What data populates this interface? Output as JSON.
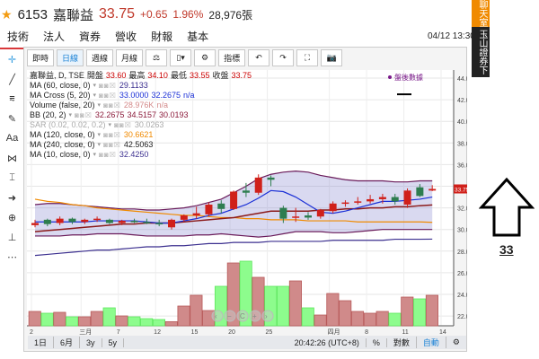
{
  "header": {
    "code": "6153",
    "name": "嘉聯益",
    "price": "33.75",
    "change": "+0.65",
    "pct": "1.96%",
    "volume": "28,976張",
    "datetime": "04/12 13:30"
  },
  "tabs": [
    "技術",
    "法人",
    "資券",
    "營收",
    "財報",
    "基本"
  ],
  "toolbar": {
    "items": [
      "即時",
      "日線",
      "週線",
      "月線",
      "⚖",
      "▯▾",
      "⚙",
      "指標",
      "↶",
      "↷",
      "⛶",
      "📷"
    ]
  },
  "left_tools": [
    "crosshair",
    "line",
    "channel",
    "brush",
    "Aa",
    "pattern",
    "measure",
    "arrow",
    "zoom",
    "ruler",
    "more"
  ],
  "legend": {
    "title": "嘉聯益, D, TSE",
    "open_label": "開盤",
    "open": "33.60",
    "high_label": "最高",
    "high": "34.10",
    "low_label": "最低",
    "low": "33.55",
    "close_label": "收盤",
    "close": "33.75",
    "rows": [
      {
        "label": "MA (60, close, 0)",
        "vals": [
          "29.1133"
        ],
        "color": "#3b2f8f"
      },
      {
        "label": "MA Cross (5, 20)",
        "vals": [
          "33.0000",
          "32.2675",
          "n/a"
        ],
        "color": "#1a2fd6"
      },
      {
        "label": "Volume (false, 20)",
        "vals": [
          "28.976K",
          "n/a"
        ],
        "color": "#d48a8a"
      },
      {
        "label": "BB (20, 2)",
        "vals": [
          "32.2675",
          "34.5157",
          "30.0193"
        ],
        "color": "#8b1a3a"
      },
      {
        "label": "SAR (0.02, 0.02, 0.2)",
        "vals": [
          "30.0263"
        ],
        "color": "#aaa"
      },
      {
        "label": "MA (120, close, 0)",
        "vals": [
          "30.6621"
        ],
        "color": "#f08a00"
      },
      {
        "label": "MA (240, close, 0)",
        "vals": [
          "42.5063"
        ],
        "color": "#222"
      },
      {
        "label": "MA (10, close, 0)",
        "vals": [
          "32.4250"
        ],
        "color": "#3b2f8f"
      }
    ]
  },
  "after_hours": "盤後數據",
  "last_price_tag": "33.75",
  "bottom": {
    "ranges": [
      "1日",
      "6月",
      "3y",
      "5y"
    ],
    "clock": "20:42:26 (UTC+8)",
    "pct": "%",
    "log": "對數",
    "auto": "自動"
  },
  "side": {
    "chat": "聊天室",
    "order": "玉山證券下單"
  },
  "annotation": "33",
  "chart_data": {
    "type": "candlestick",
    "ylim": [
      21,
      45
    ],
    "yticks": [
      "44.00",
      "42.00",
      "40.00",
      "38.00",
      "36.00",
      "34.00",
      "32.00",
      "30.00",
      "28.00",
      "26.00",
      "24.00",
      "22.00"
    ],
    "xticks": [
      {
        "i": 0,
        "t": "2"
      },
      {
        "i": 4,
        "t": "三月"
      },
      {
        "i": 7,
        "t": "7"
      },
      {
        "i": 10,
        "t": "12"
      },
      {
        "i": 13,
        "t": "15"
      },
      {
        "i": 16,
        "t": "20"
      },
      {
        "i": 19,
        "t": "25"
      },
      {
        "i": 24,
        "t": "四月"
      },
      {
        "i": 27,
        "t": "8"
      },
      {
        "i": 30,
        "t": "11"
      },
      {
        "i": 33,
        "t": "14"
      }
    ],
    "ohlc": [
      [
        30.4,
        30.9,
        30.2,
        30.6
      ],
      [
        30.9,
        31.0,
        30.3,
        30.5
      ],
      [
        30.6,
        31.2,
        30.4,
        31.0
      ],
      [
        31.0,
        31.1,
        30.5,
        30.7
      ],
      [
        30.7,
        31.0,
        30.5,
        30.9
      ],
      [
        30.9,
        31.2,
        30.7,
        31.0
      ],
      [
        30.9,
        31.0,
        30.5,
        30.6
      ],
      [
        30.6,
        30.9,
        30.4,
        30.8
      ],
      [
        30.8,
        31.0,
        30.6,
        30.7
      ],
      [
        30.7,
        31.0,
        30.5,
        30.6
      ],
      [
        30.6,
        30.9,
        30.3,
        30.5
      ],
      [
        30.2,
        31.0,
        30.0,
        30.9
      ],
      [
        30.9,
        31.4,
        30.7,
        31.3
      ],
      [
        31.3,
        32.1,
        31.0,
        31.5
      ],
      [
        31.4,
        32.5,
        31.2,
        32.3
      ],
      [
        32.4,
        32.7,
        31.5,
        31.9
      ],
      [
        31.9,
        33.6,
        31.8,
        33.5
      ],
      [
        33.6,
        34.3,
        33.0,
        33.4
      ],
      [
        33.4,
        35.1,
        33.2,
        34.8
      ],
      [
        34.8,
        35.0,
        34.0,
        34.6
      ],
      [
        32.0,
        32.2,
        30.6,
        31.0
      ],
      [
        31.1,
        32.0,
        30.7,
        31.2
      ],
      [
        31.3,
        31.6,
        30.9,
        31.1
      ],
      [
        31.2,
        31.9,
        31.0,
        31.8
      ],
      [
        31.7,
        32.6,
        31.5,
        32.4
      ],
      [
        32.4,
        32.7,
        32.1,
        32.5
      ],
      [
        32.6,
        33.0,
        32.3,
        32.6
      ],
      [
        32.6,
        33.2,
        32.4,
        32.8
      ],
      [
        32.8,
        33.3,
        32.4,
        33.0
      ],
      [
        33.0,
        33.3,
        32.3,
        32.6
      ],
      [
        32.3,
        33.8,
        32.0,
        33.6
      ],
      [
        33.9,
        34.2,
        33.0,
        33.1
      ],
      [
        33.6,
        34.1,
        33.55,
        33.75
      ]
    ],
    "volume": [
      8,
      7,
      7.5,
      5,
      5,
      8,
      10,
      5.5,
      5,
      4,
      3.5,
      2.3,
      11,
      17,
      8.5,
      22,
      35,
      36,
      27,
      22,
      22,
      25,
      10,
      6,
      18,
      14,
      8,
      7,
      8,
      7,
      16,
      15,
      17
    ],
    "bb_upper": [
      32.3,
      32.4,
      32.4,
      32.3,
      32.2,
      32.1,
      32.0,
      31.9,
      31.9,
      31.8,
      31.8,
      31.9,
      32.0,
      32.2,
      32.5,
      32.8,
      33.4,
      34.0,
      34.7,
      35.1,
      35.3,
      35.4,
      35.3,
      35.0,
      34.8,
      34.6,
      34.5,
      34.5,
      34.5,
      34.4,
      34.4,
      34.5,
      34.5
    ],
    "bb_lower": [
      29.4,
      29.4,
      29.4,
      29.5,
      29.5,
      29.6,
      29.6,
      29.6,
      29.5,
      29.4,
      29.4,
      29.4,
      29.4,
      29.5,
      29.5,
      29.6,
      29.5,
      29.4,
      29.3,
      29.4,
      29.6,
      29.8,
      29.8,
      29.8,
      29.7,
      29.7,
      29.8,
      29.9,
      30.0,
      30.0,
      30.0,
      30.0,
      30.0
    ],
    "ma5": [
      30.7,
      30.7,
      30.7,
      30.7,
      30.7,
      30.8,
      30.8,
      30.8,
      30.8,
      30.7,
      30.6,
      30.6,
      30.8,
      31.0,
      31.3,
      31.5,
      31.9,
      32.3,
      32.9,
      33.6,
      33.5,
      33.0,
      32.3,
      31.6,
      31.5,
      31.7,
      32.0,
      32.3,
      32.6,
      32.6,
      32.7,
      32.8,
      33.0
    ],
    "ma20": [
      29.8,
      29.9,
      30.0,
      30.1,
      30.2,
      30.3,
      30.4,
      30.5,
      30.5,
      30.6,
      30.6,
      30.6,
      30.7,
      30.8,
      30.9,
      31.0,
      31.1,
      31.3,
      31.5,
      31.7,
      31.7,
      31.7,
      31.7,
      31.8,
      31.8,
      31.9,
      31.9,
      32.0,
      32.0,
      32.1,
      32.1,
      32.2,
      32.27
    ],
    "ma60": [
      27.6,
      27.7,
      27.8,
      27.9,
      28.0,
      28.1,
      28.1,
      28.2,
      28.3,
      28.4,
      28.4,
      28.5,
      28.5,
      28.6,
      28.7,
      28.7,
      28.8,
      28.8,
      28.8,
      28.9,
      28.9,
      28.9,
      28.9,
      28.9,
      29.0,
      29.0,
      29.0,
      29.0,
      29.0,
      29.1,
      29.1,
      29.1,
      29.11
    ],
    "ma120": [
      32.8,
      32.6,
      32.5,
      32.3,
      32.2,
      32.0,
      31.9,
      31.8,
      31.7,
      31.6,
      31.5,
      31.4,
      31.3,
      31.3,
      31.2,
      31.1,
      31.1,
      31.0,
      31.0,
      30.9,
      30.9,
      30.9,
      30.8,
      30.8,
      30.8,
      30.8,
      30.7,
      30.7,
      30.7,
      30.7,
      30.7,
      30.7,
      30.66
    ]
  }
}
